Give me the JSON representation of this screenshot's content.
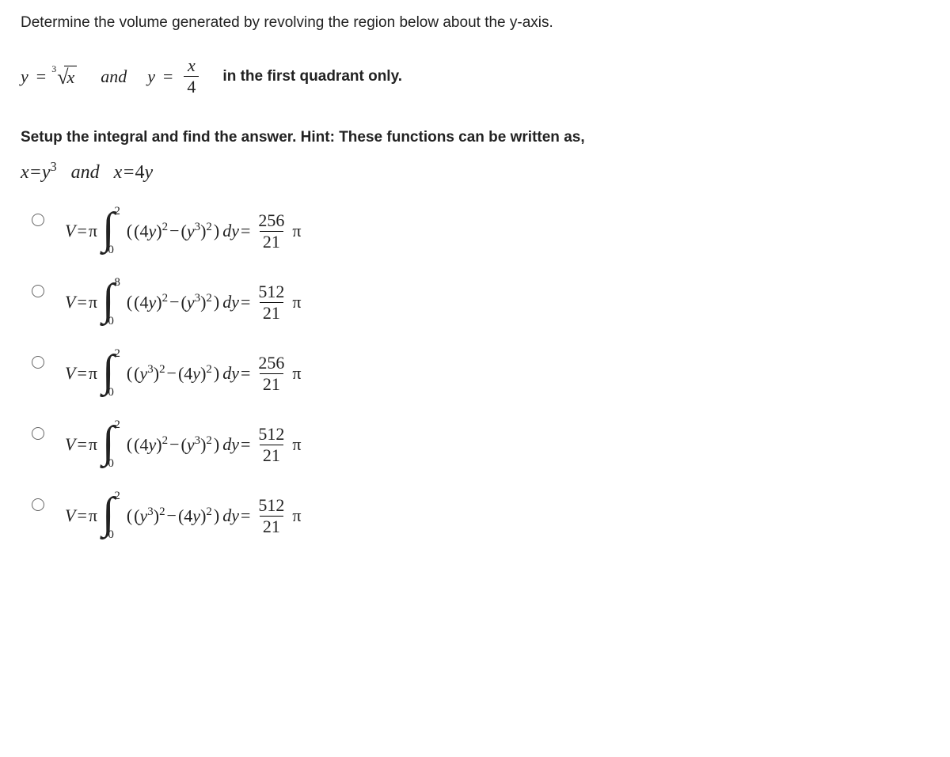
{
  "question": {
    "prompt": "Determine the volume generated by revolving the region below about the y-axis.",
    "curves_and": "and",
    "quadrant_text": "in the first quadrant only.",
    "hint": "Setup the integral and find the answer. Hint: These functions can be written as,",
    "rewrite_and": "and",
    "eq1_lhs": "x",
    "eq1_rhs": "y",
    "eq2_lhs": "x",
    "eq2_rhs": "4y"
  },
  "options": [
    {
      "upper": "2",
      "lower": "0",
      "outer_is_4y": true,
      "result_num": "256",
      "result_den": "21"
    },
    {
      "upper": "8",
      "lower": "0",
      "outer_is_4y": true,
      "result_num": "512",
      "result_den": "21"
    },
    {
      "upper": "2",
      "lower": "0",
      "outer_is_4y": false,
      "result_num": "256",
      "result_den": "21"
    },
    {
      "upper": "2",
      "lower": "0",
      "outer_is_4y": true,
      "result_num": "512",
      "result_den": "21"
    },
    {
      "upper": "2",
      "lower": "0",
      "outer_is_4y": false,
      "result_num": "512",
      "result_den": "21"
    }
  ]
}
